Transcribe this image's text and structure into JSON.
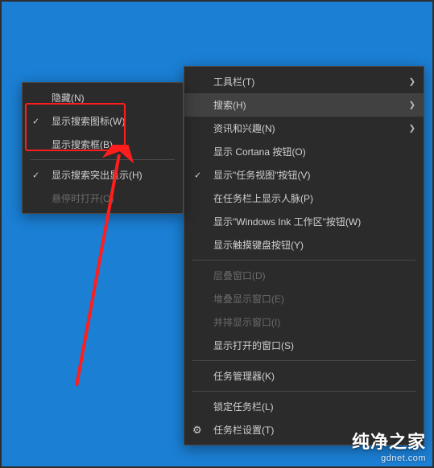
{
  "main_menu": {
    "toolbar": "工具栏(T)",
    "search": "搜索(H)",
    "news": "资讯和兴趣(N)",
    "cortana": "显示 Cortana 按钮(O)",
    "taskview": "显示\"任务视图\"按钮(V)",
    "people": "在任务栏上显示人脉(P)",
    "ink": "显示\"Windows Ink 工作区\"按钮(W)",
    "touchkb": "显示触摸键盘按钮(Y)",
    "cascade": "层叠窗口(D)",
    "stacked": "堆叠显示窗口(E)",
    "sidebyside": "并排显示窗口(I)",
    "showdesktop": "显示打开的窗口(S)",
    "taskmgr": "任务管理器(K)",
    "lock": "锁定任务栏(L)",
    "settings": "任务栏设置(T)"
  },
  "sub_menu": {
    "hidden": "隐藏(N)",
    "show_icon": "显示搜索图标(W)",
    "show_box": "显示搜索框(B)",
    "highlights": "显示搜索突出显示(H)",
    "open_hover": "悬停时打开(O)"
  },
  "watermark": {
    "cn": "纯净之家",
    "en": "gdnet.com"
  }
}
